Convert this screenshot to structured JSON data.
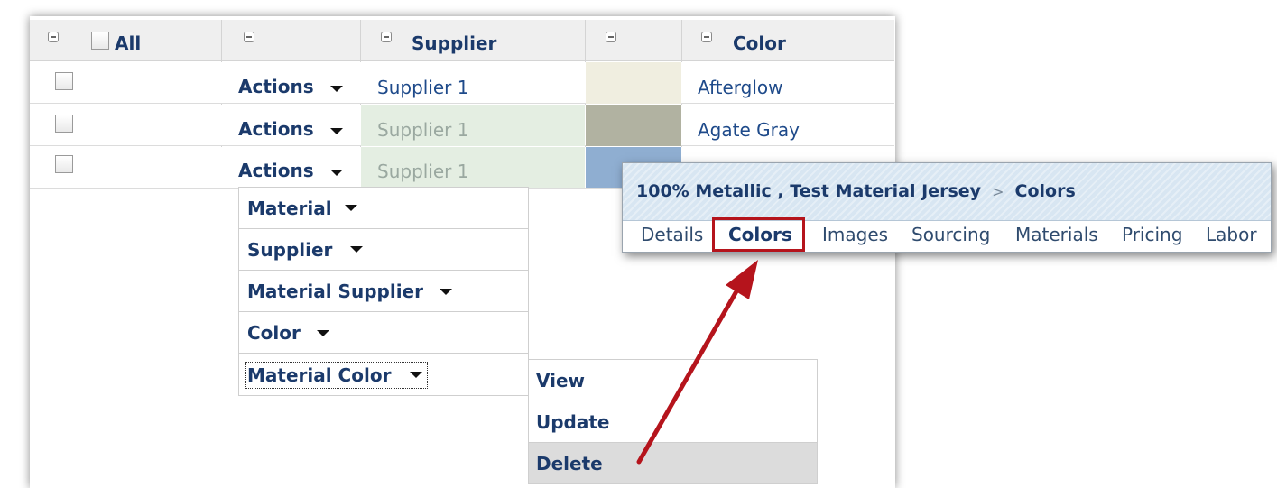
{
  "grid": {
    "header": {
      "all_label": "All",
      "supplier_label": "Supplier",
      "color_label": "Color"
    },
    "rows": [
      {
        "actions_label": "Actions",
        "supplier": "Supplier 1",
        "color_name": "Afterglow",
        "swatch": "#f0eee0"
      },
      {
        "actions_label": "Actions",
        "supplier": "Supplier 1",
        "color_name": "Agate Gray",
        "swatch": "#b1b2a1"
      },
      {
        "actions_label": "Actions",
        "supplier": "Supplier 1",
        "color_name": "",
        "swatch": "#8faed1"
      }
    ]
  },
  "actions_menu": {
    "items": [
      "Material",
      "Supplier",
      "Material Supplier",
      "Color",
      "Material Color"
    ]
  },
  "submenu": {
    "items": [
      "View",
      "Update",
      "Delete"
    ]
  },
  "popup": {
    "breadcrumb_parent": "100% Metallic , Test Material Jersey",
    "separator": ">",
    "breadcrumb_current": "Colors",
    "tabs": [
      "Details",
      "Colors",
      "Images",
      "Sourcing",
      "Materials",
      "Pricing",
      "Labor"
    ],
    "active_tab": "Colors"
  },
  "colors": {
    "link": "#1e4a8a",
    "highlight_box": "#b5141c",
    "arrow": "#b5141c",
    "header_bg": "#efefef",
    "faded_cell_bg": "#e4eee2"
  }
}
